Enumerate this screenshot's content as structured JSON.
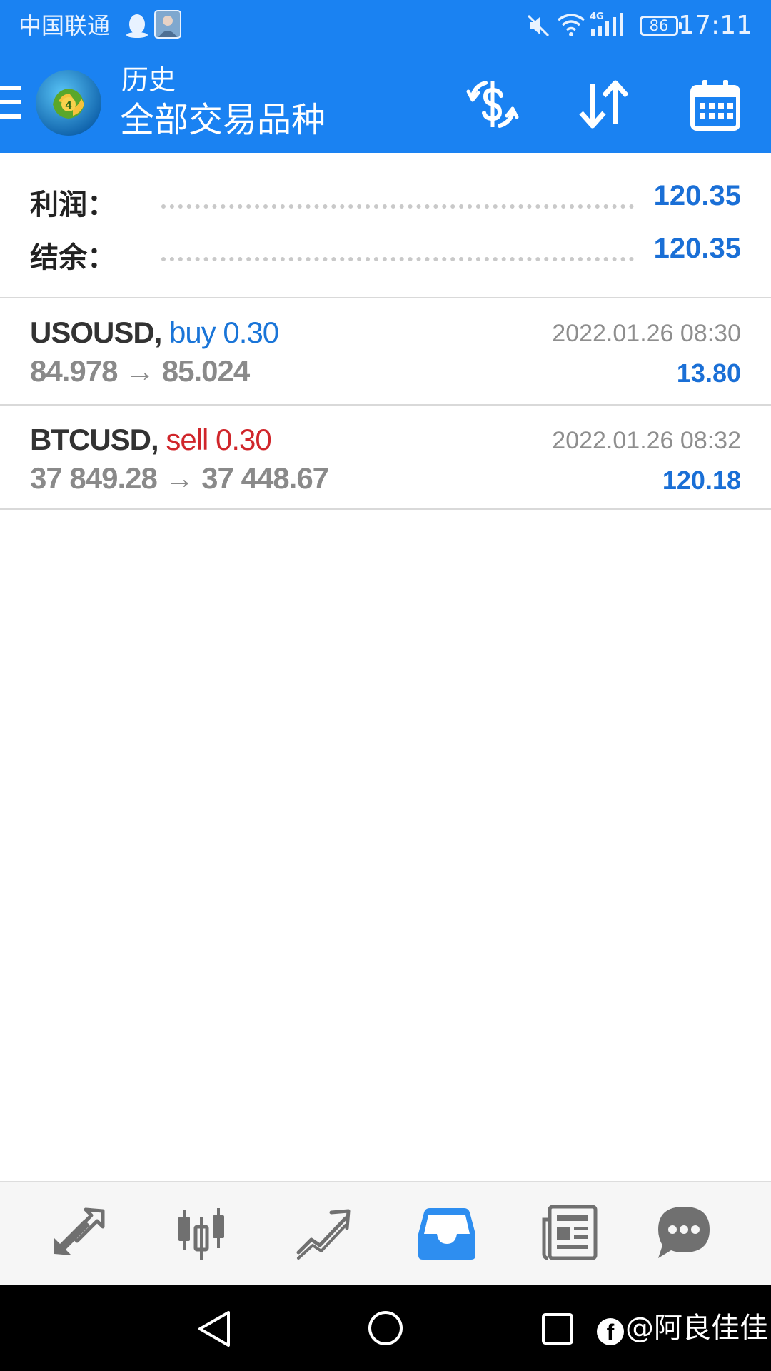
{
  "status_bar": {
    "carrier": "中国联通",
    "battery": "86",
    "time": "17:11",
    "network": "4G"
  },
  "app_bar": {
    "subtitle": "历史",
    "title": "全部交易品种"
  },
  "summary": {
    "profit_label": "利润：",
    "profit_value": "120.35",
    "balance_label": "结余：",
    "balance_value": "120.35"
  },
  "deals": [
    {
      "symbol": "USOUSD,",
      "type": "buy 0.30",
      "prices": "84.978 → 85.024",
      "time": "2022.01.26 08:30",
      "profit": "13.80"
    },
    {
      "symbol": "BTCUSD,",
      "type": "sell 0.30",
      "prices": "37 849.28 → 37 448.67",
      "time": "2022.01.26 08:32",
      "profit": "120.18"
    }
  ],
  "tabs": [
    {
      "icon": "quotes-icon"
    },
    {
      "icon": "chart-candles-icon"
    },
    {
      "icon": "trade-icon"
    },
    {
      "icon": "history-inbox-icon",
      "active": true
    },
    {
      "icon": "news-icon"
    },
    {
      "icon": "chat-icon"
    }
  ],
  "watermark": {
    "badge": "f",
    "text": "@阿良佳佳"
  },
  "colors": {
    "primary": "#1a82f2",
    "profit_blue": "#1a6fd6",
    "sell_red": "#d0262b",
    "tab_active": "#2e8ef0",
    "tab_inactive": "#707070"
  }
}
